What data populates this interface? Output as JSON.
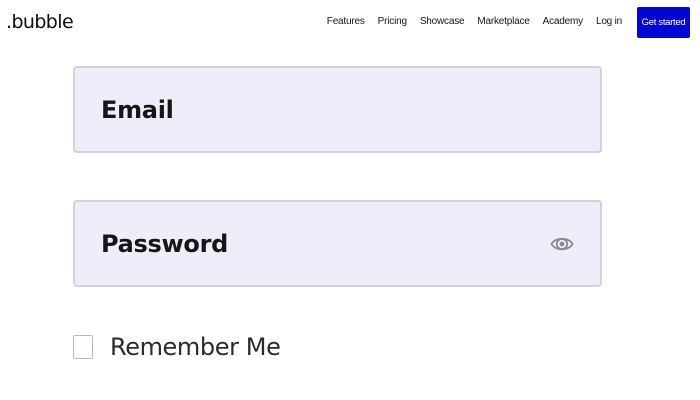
{
  "nav": {
    "logo": ".bubble",
    "links": [
      "Features",
      "Pricing",
      "Showcase",
      "Marketplace",
      "Academy",
      "Log in"
    ],
    "cta_label": "Get started",
    "cta_color": "#0205d3"
  },
  "form": {
    "email_placeholder": "Email",
    "password_placeholder": "Password",
    "password_toggle_icon": "eye-icon",
    "remember_label": "Remember Me",
    "remember_checked": false,
    "field_background": "#eeeefb"
  }
}
